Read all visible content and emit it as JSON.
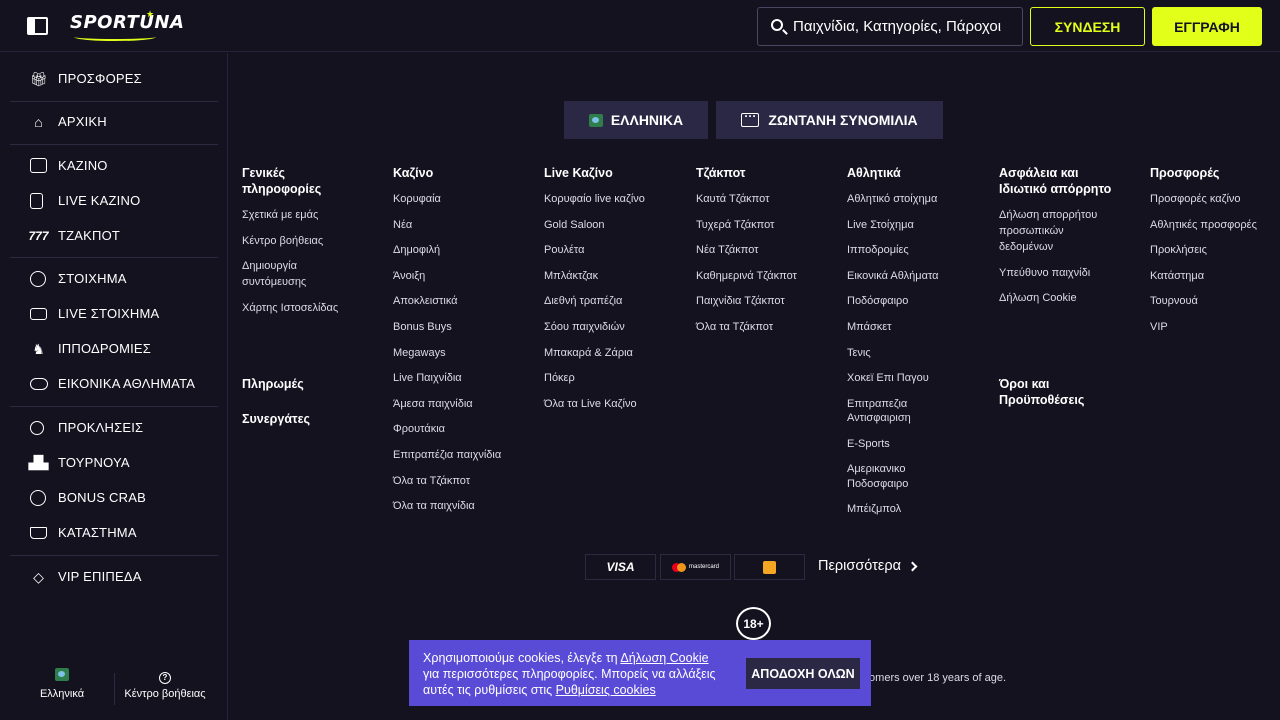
{
  "header": {
    "logo": "SPORTUNA",
    "search_placeholder": "Παιχνίδια, Κατηγορίες, Πάροχοι",
    "login_label": "ΣΥΝΔΕΣΗ",
    "register_label": "ΕΓΓΡΑΦΗ"
  },
  "sidebar": {
    "items": [
      {
        "label": "ΠΡΟΣΦΟΡΕΣ",
        "icon": "gift-icon"
      },
      {
        "label": "ΑΡΧΙΚΗ",
        "icon": "home-icon"
      },
      {
        "label": "ΚΑΖΙΝΟ",
        "icon": "slot-machine-icon"
      },
      {
        "label": "LIVE ΚΑΖΙΝΟ",
        "icon": "card-icon"
      },
      {
        "label": "ΤΖΑΚΠΟΤ",
        "icon": "jackpot-icon"
      },
      {
        "label": "ΣΤΟΙΧΗΜΑ",
        "icon": "soccer-ball-icon"
      },
      {
        "label": "LIVE ΣΤΟΙΧΗΜΑ",
        "icon": "video-camera-icon"
      },
      {
        "label": "ΙΠΠΟΔΡΟΜΙΕΣ",
        "icon": "horse-icon"
      },
      {
        "label": "ΕΙΚΟΝΙΚΑ ΑΘΛΗΜΑΤΑ",
        "icon": "gamepad-icon"
      },
      {
        "label": "ΠΡΟΚΛΗΣΕΙΣ",
        "icon": "medal-icon"
      },
      {
        "label": "ΤΟΥΡΝΟΥΑ",
        "icon": "podium-icon"
      },
      {
        "label": "BONUS CRAB",
        "icon": "crab-claw-icon"
      },
      {
        "label": "ΚΑΤΑΣΤΗΜΑ",
        "icon": "basket-icon"
      },
      {
        "label": "VIP ΕΠΙΠΕΔΑ",
        "icon": "diamond-icon"
      }
    ],
    "footer": {
      "language_label": "Ελληνικά",
      "help_label": "Κέντρο βοήθειας"
    }
  },
  "main": {
    "language_button": "ΕΛΛΗΝΙΚΑ",
    "chat_button": "ΖΩΝΤΑΝΗ ΣΥΝΟΜΙΛΙΑ",
    "columns": {
      "general": {
        "title_1": "Γενικές",
        "title_2": "πληροφορίες",
        "links": [
          "Σχετικά με εμάς",
          "Κέντρο βοήθειας",
          "Δημιουργία",
          "συντόμευσης",
          "Χάρτης Ιστοσελίδας"
        ],
        "payments": "Πληρωμές",
        "partners": "Συνεργάτες"
      },
      "casino": {
        "title": "Καζίνο",
        "links": [
          "Κορυφαία",
          "Νέα",
          "Δημοφιλή",
          "Άνοιξη",
          "Αποκλειστικά",
          "Bonus Buys",
          "Megaways",
          "Live Παιχνίδια",
          "Άμεσα παιχνίδια",
          "Φρουτάκια",
          "Επιτραπέζια παιχνίδια",
          "Όλα τα Τζάκποτ",
          "Όλα τα παιχνίδια"
        ]
      },
      "live_casino": {
        "title": "Live Καζίνο",
        "links": [
          "Κορυφαίο live καζίνο",
          "Gold Saloon",
          "Ρουλέτα",
          "Μπλάκτζακ",
          "Διεθνή τραπέζια",
          "Σόου παιχνιδιών",
          "Μπακαρά & Ζάρια",
          "Πόκερ",
          "Όλα τα Live Καζίνο"
        ]
      },
      "jackpot": {
        "title": "Τζάκποτ",
        "links": [
          "Καυτά Τζάκποτ",
          "Τυχερά Τζάκποτ",
          "Νέα Τζάκποτ",
          "Καθημερινά Τζάκποτ",
          "Παιχνίδια Τζάκποτ",
          "Όλα τα Τζάκποτ"
        ]
      },
      "sports": {
        "title": "Αθλητικά",
        "links": [
          "Αθλητικό στοίχημα",
          "Live Στοίχημα",
          "Ιπποδρομίες",
          "Εικονικά Αθλήματα",
          "Ποδόσφαιρο",
          "Μπάσκετ",
          "Τενις",
          "Χοκεϊ Επι Παγου",
          "Επιτραπεζια",
          "Αντισφαιριση",
          "E-Sports",
          "Αμερικανικο",
          "Ποδοσφαιρο",
          "Μπέιζμπολ"
        ]
      },
      "security": {
        "title_1": "Ασφάλεια και",
        "title_2": "Ιδιωτικό απόρρητο",
        "links": [
          "Δήλωση απορρήτου",
          "προσωπικών",
          "δεδομένων",
          "Υπεύθυνο παιχνίδι",
          "Δήλωση Cookie"
        ],
        "terms_1": "Όροι και",
        "terms_2": "Προϋποθέσεις"
      },
      "offers": {
        "title": "Προσφορές",
        "links": [
          "Προσφορές καζίνο",
          "Αθλητικές προσφορές",
          "Προκλήσεις",
          "Κατάστημα",
          "Τουρνουά",
          "VIP"
        ]
      }
    },
    "payments": {
      "visa": "VISA",
      "mastercard": "mastercard",
      "more_label": "Περισσότερα"
    },
    "age_badge": "18+",
    "age_text": "tomers over 18 years of age."
  },
  "cookie_banner": {
    "line1_prefix": "Χρησιμοποιούμε cookies, έλεγξε τη ",
    "line1_link": "Δήλωση Cookie",
    "line2": "για περισσότερες πληροφορίες. Μπορείς να αλλάξεις",
    "line3_prefix": "αυτές τις ρυθμίσεις στις ",
    "line3_link": "Ρυθμίσεις cookies",
    "accept_label": "ΑΠΟΔΟΧΗ ΟΛΩΝ"
  },
  "colors": {
    "background": "#14121f",
    "accent": "#e2ff1a",
    "button_dark": "#2b2846",
    "cookie_bg": "#5a4bd6"
  }
}
